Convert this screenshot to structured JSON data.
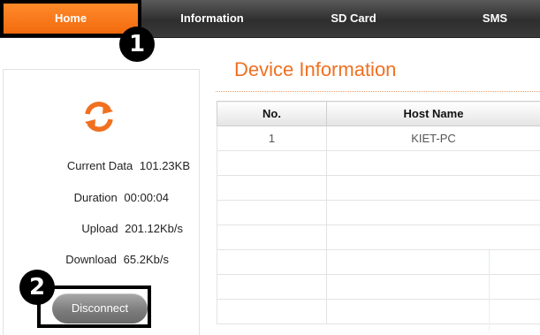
{
  "nav": {
    "home": "Home",
    "information": "Information",
    "sd_card": "SD Card",
    "sms": "SMS"
  },
  "callouts": {
    "first": "1",
    "second": "2"
  },
  "status": {
    "current_data_label": "Current Data",
    "current_data_value": "101.23KB",
    "duration_label": "Duration",
    "duration_value": "00:00:04",
    "upload_label": "Upload",
    "upload_value": "201.12Kb/s",
    "download_label": "Download",
    "download_value": "65.2Kb/s",
    "disconnect_label": "Disconnect"
  },
  "device_info": {
    "title": "Device Information",
    "columns": [
      "No.",
      "Host Name"
    ],
    "rows": [
      [
        "1",
        "KIET-PC"
      ],
      [
        "",
        ""
      ],
      [
        "",
        ""
      ],
      [
        "",
        ""
      ],
      [
        "",
        ""
      ],
      [
        "",
        ""
      ],
      [
        "",
        ""
      ],
      [
        "",
        ""
      ]
    ]
  },
  "colors": {
    "accent_orange": "#f07020",
    "nav_dark": "#3a3a3a",
    "button_gray": "#7d7d7d"
  },
  "icons": {
    "refresh": "refresh-icon"
  }
}
